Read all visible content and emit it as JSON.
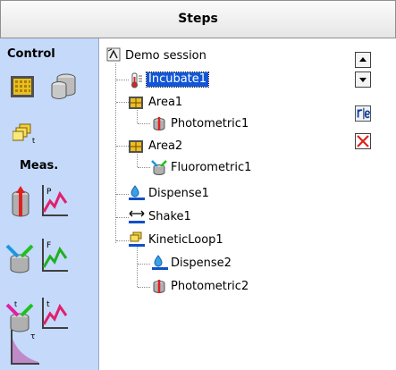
{
  "header": {
    "title": "Steps"
  },
  "sidebar": {
    "control_label": "Control",
    "meas_label": "Meas."
  },
  "tree": {
    "root": "Demo session",
    "items": [
      {
        "label": "Incubate1",
        "selected": true
      },
      {
        "label": "Area1"
      },
      {
        "label": "Photometric1"
      },
      {
        "label": "Area2"
      },
      {
        "label": "Fluorometric1"
      },
      {
        "label": "Dispense1"
      },
      {
        "label": "Shake1"
      },
      {
        "label": "KineticLoop1"
      },
      {
        "label": "Dispense2"
      },
      {
        "label": "Photometric2"
      }
    ]
  },
  "toolbar": {
    "buttons": [
      "move-up-icon",
      "move-down-icon",
      "rename-icon",
      "delete-icon"
    ]
  },
  "colors": {
    "sidebar_bg": "#c5d9fa",
    "selection": "#1256d8",
    "delete_red": "#e0201b"
  }
}
